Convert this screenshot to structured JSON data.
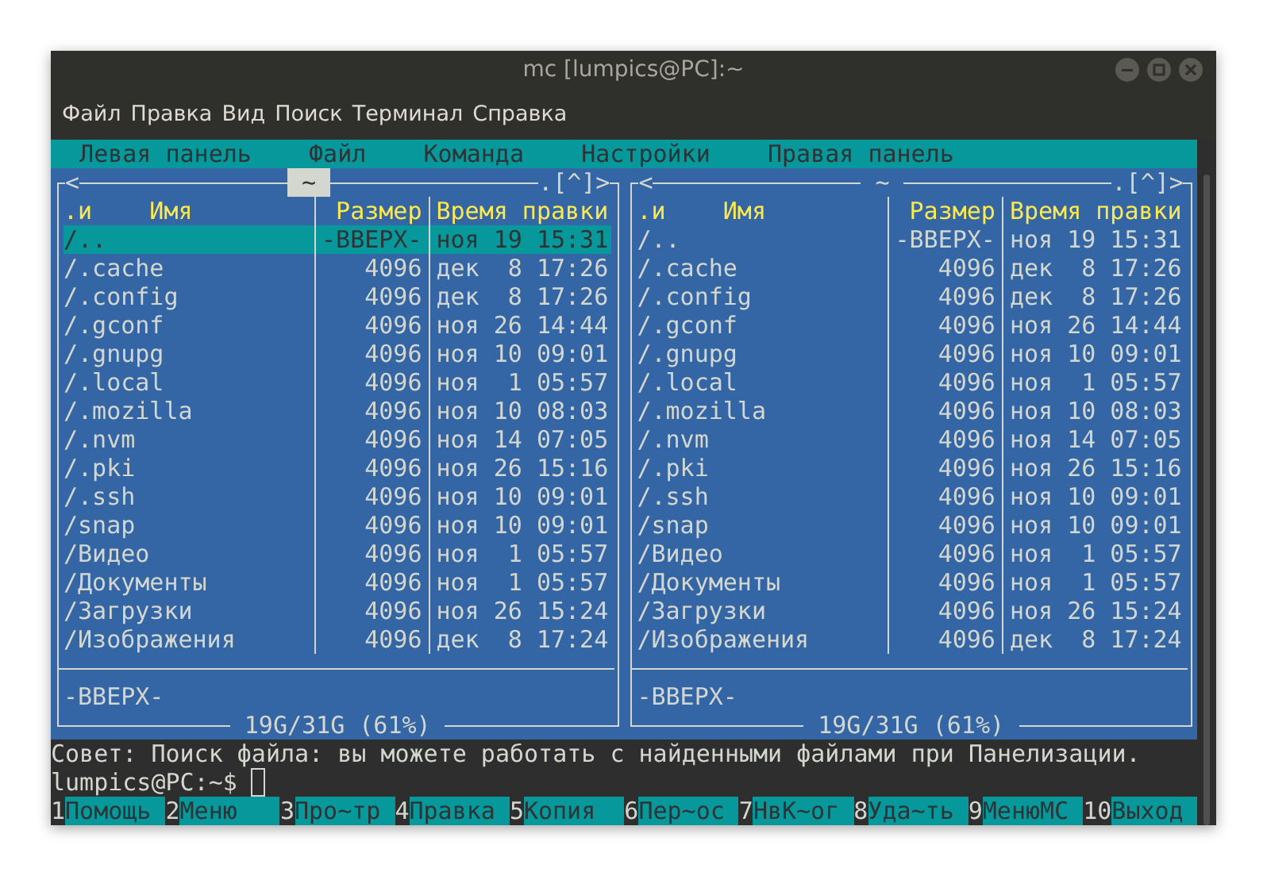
{
  "window": {
    "title": "mc [lumpics@PC]:~"
  },
  "menu": [
    "Файл",
    "Правка",
    "Вид",
    "Поиск",
    "Терминал",
    "Справка"
  ],
  "mc_menu": [
    "Левая панель",
    "Файл",
    "Команда",
    "Настройки",
    "Правая панель"
  ],
  "panels": [
    {
      "active": true,
      "back": "<",
      "path": "~",
      "scroll": ".[^]>",
      "columns": {
        "sort": ".и",
        "name": "Имя",
        "size": "Размер",
        "time": "Время правки"
      },
      "rows": [
        {
          "name": "/..",
          "size": "-ВВЕРХ-",
          "time": "ноя 19 15:31",
          "selected": true
        },
        {
          "name": "/.cache",
          "size": "4096",
          "time": "дек  8 17:26",
          "selected": false
        },
        {
          "name": "/.config",
          "size": "4096",
          "time": "дек  8 17:26",
          "selected": false
        },
        {
          "name": "/.gconf",
          "size": "4096",
          "time": "ноя 26 14:44",
          "selected": false
        },
        {
          "name": "/.gnupg",
          "size": "4096",
          "time": "ноя 10 09:01",
          "selected": false
        },
        {
          "name": "/.local",
          "size": "4096",
          "time": "ноя  1 05:57",
          "selected": false
        },
        {
          "name": "/.mozilla",
          "size": "4096",
          "time": "ноя 10 08:03",
          "selected": false
        },
        {
          "name": "/.nvm",
          "size": "4096",
          "time": "ноя 14 07:05",
          "selected": false
        },
        {
          "name": "/.pki",
          "size": "4096",
          "time": "ноя 26 15:16",
          "selected": false
        },
        {
          "name": "/.ssh",
          "size": "4096",
          "time": "ноя 10 09:01",
          "selected": false
        },
        {
          "name": "/snap",
          "size": "4096",
          "time": "ноя 10 09:01",
          "selected": false
        },
        {
          "name": "/Видео",
          "size": "4096",
          "time": "ноя  1 05:57",
          "selected": false
        },
        {
          "name": "/Документы",
          "size": "4096",
          "time": "ноя  1 05:57",
          "selected": false
        },
        {
          "name": "/Загрузки",
          "size": "4096",
          "time": "ноя 26 15:24",
          "selected": false
        },
        {
          "name": "/Изображения",
          "size": "4096",
          "time": "дек  8 17:24",
          "selected": false
        }
      ],
      "mini_status": "-ВВЕРХ-",
      "disk": "19G/31G (61%)"
    },
    {
      "active": false,
      "back": "<",
      "path": "~",
      "scroll": ".[^]>",
      "columns": {
        "sort": ".и",
        "name": "Имя",
        "size": "Размер",
        "time": "Время правки"
      },
      "rows": [
        {
          "name": "/..",
          "size": "-ВВЕРХ-",
          "time": "ноя 19 15:31",
          "selected": false
        },
        {
          "name": "/.cache",
          "size": "4096",
          "time": "дек  8 17:26",
          "selected": false
        },
        {
          "name": "/.config",
          "size": "4096",
          "time": "дек  8 17:26",
          "selected": false
        },
        {
          "name": "/.gconf",
          "size": "4096",
          "time": "ноя 26 14:44",
          "selected": false
        },
        {
          "name": "/.gnupg",
          "size": "4096",
          "time": "ноя 10 09:01",
          "selected": false
        },
        {
          "name": "/.local",
          "size": "4096",
          "time": "ноя  1 05:57",
          "selected": false
        },
        {
          "name": "/.mozilla",
          "size": "4096",
          "time": "ноя 10 08:03",
          "selected": false
        },
        {
          "name": "/.nvm",
          "size": "4096",
          "time": "ноя 14 07:05",
          "selected": false
        },
        {
          "name": "/.pki",
          "size": "4096",
          "time": "ноя 26 15:16",
          "selected": false
        },
        {
          "name": "/.ssh",
          "size": "4096",
          "time": "ноя 10 09:01",
          "selected": false
        },
        {
          "name": "/snap",
          "size": "4096",
          "time": "ноя 10 09:01",
          "selected": false
        },
        {
          "name": "/Видео",
          "size": "4096",
          "time": "ноя  1 05:57",
          "selected": false
        },
        {
          "name": "/Документы",
          "size": "4096",
          "time": "ноя  1 05:57",
          "selected": false
        },
        {
          "name": "/Загрузки",
          "size": "4096",
          "time": "ноя 26 15:24",
          "selected": false
        },
        {
          "name": "/Изображения",
          "size": "4096",
          "time": "дек  8 17:24",
          "selected": false
        }
      ],
      "mini_status": "-ВВЕРХ-",
      "disk": "19G/31G (61%)"
    }
  ],
  "tip": "Совет: Поиск файла: вы можете работать с найденными файлами при Панелизации.",
  "prompt": "lumpics@PC:~$",
  "keybar": [
    {
      "key": "1",
      "label": "Помощь"
    },
    {
      "key": "2",
      "label": "Меню"
    },
    {
      "key": "3",
      "label": "Про~тр"
    },
    {
      "key": "4",
      "label": "Правка"
    },
    {
      "key": "5",
      "label": "Копия"
    },
    {
      "key": "6",
      "label": "Пер~ос"
    },
    {
      "key": "7",
      "label": "НвК~ог"
    },
    {
      "key": "8",
      "label": "Уда~ть"
    },
    {
      "key": "9",
      "label": "МенюМС"
    },
    {
      "key": "10",
      "label": "Выход"
    }
  ]
}
